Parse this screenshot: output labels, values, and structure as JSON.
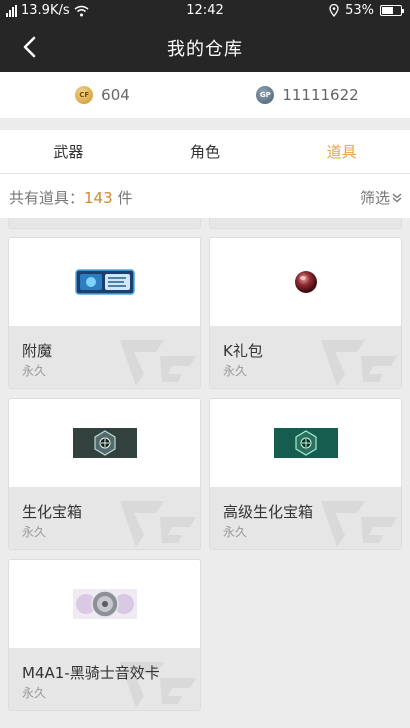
{
  "status": {
    "network": "13.9K/s",
    "time": "12:42",
    "battery": "53%",
    "battery_level": 0.53
  },
  "nav": {
    "title": "我的仓库"
  },
  "currency": [
    {
      "icon": "cf-coin-icon",
      "value": "604"
    },
    {
      "icon": "gp-coin-icon",
      "value": "11111622"
    }
  ],
  "tabs": [
    {
      "label": "武器",
      "active": false
    },
    {
      "label": "角色",
      "active": false
    },
    {
      "label": "道具",
      "active": true
    }
  ],
  "summary": {
    "prefix": "共有道具：",
    "count": "143",
    "unit": "件",
    "filter": "筛选"
  },
  "items": [
    {
      "name": "附魔",
      "duration": "永久",
      "icon": "enchant-scroll-icon"
    },
    {
      "name": "K礼包",
      "duration": "永久",
      "icon": "gift-orb-icon"
    },
    {
      "name": "生化宝箱",
      "duration": "永久",
      "icon": "bio-box-icon"
    },
    {
      "name": "高级生化宝箱",
      "duration": "永久",
      "icon": "advanced-bio-box-icon"
    },
    {
      "name": "M4A1-黑骑士音效卡",
      "duration": "永久",
      "icon": "sound-card-icon"
    }
  ],
  "colors": {
    "accent": "#e8a33b",
    "header": "#262626"
  }
}
